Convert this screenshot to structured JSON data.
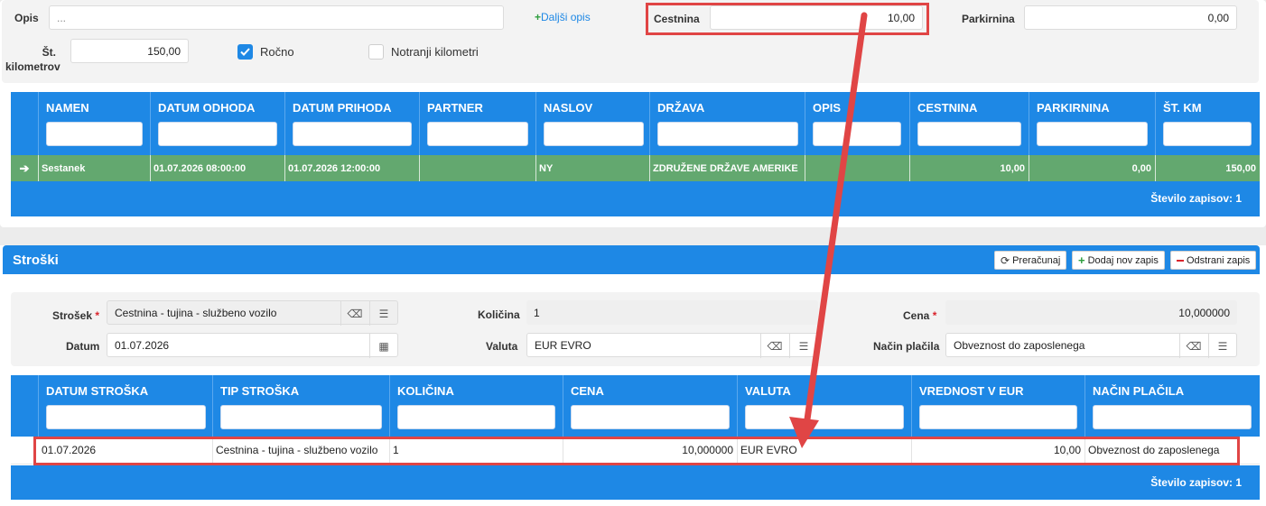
{
  "trip_form": {
    "opis_label": "Opis",
    "opis_value": "...",
    "dalsi_opis_link": "Daljši opis",
    "cestnina_label": "Cestnina",
    "cestnina_value": "10,00",
    "parkirnina_label": "Parkirnina",
    "parkirnina_value": "0,00",
    "km_label_line1": "Št.",
    "km_label_line2": "kilometrov",
    "km_value": "150,00",
    "rocno_label": "Ročno",
    "rocno_checked": true,
    "notranji_label": "Notranji kilometri",
    "notranji_checked": false
  },
  "trip_grid": {
    "columns": [
      "NAMEN",
      "DATUM ODHODA",
      "DATUM PRIHODA",
      "PARTNER",
      "NASLOV",
      "DRŽAVA",
      "OPIS",
      "CESTNINA",
      "PARKIRNINA",
      "ŠT. KM"
    ],
    "row": [
      "Sestanek",
      "01.07.2026 08:00:00",
      "01.07.2026 12:00:00",
      "",
      "NY",
      "ZDRUŽENE DRŽAVE AMERIKE",
      "",
      "10,00",
      "0,00",
      "150,00"
    ],
    "footer": "Število zapisov: 1"
  },
  "stroski": {
    "title": "Stroški",
    "buttons": {
      "preracunaj": "Preračunaj",
      "dodaj": "Dodaj nov zapis",
      "odstrani": "Odstrani zapis"
    },
    "form": {
      "strosek_label": "Strošek",
      "strosek_value": "Cestnina - tujina - službeno vozilo",
      "datum_label": "Datum",
      "datum_value": "01.07.2026",
      "kolicina_label": "Količina",
      "kolicina_value": "1",
      "valuta_label": "Valuta",
      "valuta_value": "EUR EVRO",
      "cena_label": "Cena",
      "cena_value": "10,000000",
      "nacin_label": "Način plačila",
      "nacin_value": "Obveznost do zaposlenega",
      "required_mark": "*"
    },
    "grid": {
      "columns": [
        "DATUM STROŠKA",
        "TIP STROŠKA",
        "KOLIČINA",
        "CENA",
        "VALUTA",
        "VREDNOST V EUR",
        "NAČIN PLAČILA"
      ],
      "row": [
        "01.07.2026",
        "Cestnina - tujina - službeno vozilo",
        "1",
        "10,000000",
        "EUR EVRO",
        "10,00",
        "Obveznost do zaposlenega"
      ],
      "footer": "Število zapisov: 1"
    }
  },
  "colors": {
    "header_blue": "#1e88e5",
    "selected_row_green": "#63a86f",
    "annotation_red": "#e04545",
    "link_green": "#2e9e3e"
  },
  "icons": {
    "eraser": "eraser-icon",
    "list": "list-icon",
    "calendar": "calendar-icon",
    "refresh": "refresh-icon",
    "plus": "plus-icon",
    "minus": "minus-icon",
    "row_arrow": "arrow-right-icon"
  }
}
